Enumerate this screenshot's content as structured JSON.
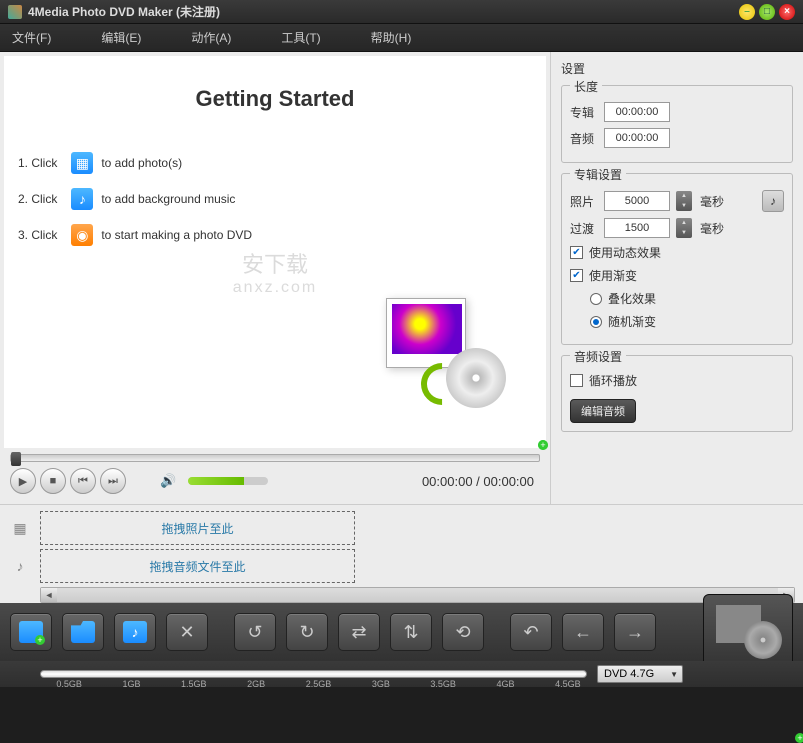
{
  "titlebar": {
    "title": "4Media Photo DVD Maker (未注册)"
  },
  "menu": {
    "file": "文件(F)",
    "edit": "编辑(E)",
    "action": "动作(A)",
    "tools": "工具(T)",
    "help": "帮助(H)"
  },
  "getting_started": {
    "title": "Getting Started",
    "step1_prefix": "1. Click",
    "step1_text": "to add photo(s)",
    "step2_prefix": "2. Click",
    "step2_text": "to add background music",
    "step3_prefix": "3. Click",
    "step3_text": "to start making a photo DVD"
  },
  "watermark": {
    "line1": "安下载",
    "line2": "anxz.com"
  },
  "transport": {
    "time": "00:00:00 / 00:00:00"
  },
  "settings": {
    "title": "设置",
    "duration": {
      "legend": "长度",
      "album_label": "专辑",
      "album_value": "00:00:00",
      "audio_label": "音频",
      "audio_value": "00:00:00"
    },
    "album": {
      "legend": "专辑设置",
      "photo_label": "照片",
      "photo_value": "5000",
      "photo_unit": "毫秒",
      "transition_label": "过渡",
      "transition_value": "1500",
      "transition_unit": "毫秒",
      "use_motion": "使用动态效果",
      "use_fade": "使用渐变",
      "overlap": "叠化效果",
      "random": "随机渐变"
    },
    "audio": {
      "legend": "音频设置",
      "loop": "循环播放",
      "edit_btn": "编辑音频"
    }
  },
  "timeline": {
    "drop_photos": "拖拽照片至此",
    "drop_audio": "拖拽音频文件至此"
  },
  "capacity": {
    "ticks": [
      "0.5GB",
      "1GB",
      "1.5GB",
      "2GB",
      "2.5GB",
      "3GB",
      "3.5GB",
      "4GB",
      "4.5GB"
    ],
    "dvd_label": "DVD 4.7G"
  }
}
